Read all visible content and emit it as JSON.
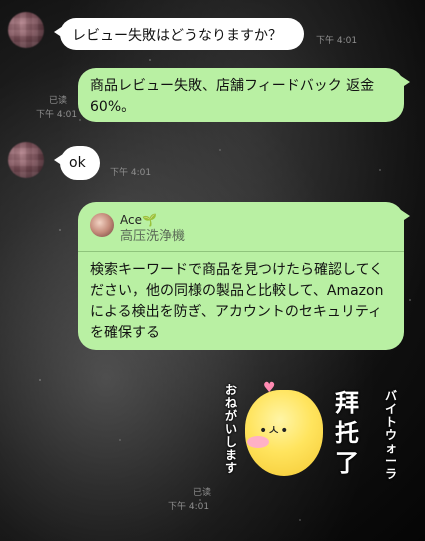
{
  "messages": [
    {
      "text": "レビュー失敗はどうなりますか？",
      "time": "下午 4:01"
    },
    {
      "text": "商品レビュー失敗、店舗フィードバック 返金60%。",
      "read": "已读",
      "time": "下午 4:01"
    },
    {
      "text": "ok",
      "time": "下午 4:01"
    },
    {
      "reply_to": {
        "name": "Ace🌱",
        "text": "高压洗浄機"
      },
      "text": "検索キーワードで商品を見つけたら確認してください，他の同様の製品と比較して、Amazonによる検出を防ぎ、アカウントのセキュリティを確保する"
    }
  ],
  "sticker": {
    "label_main": "拜托了",
    "label_side": "バイトウォーラ",
    "label_left": "おねがいします",
    "read": "已读",
    "time": "下午 4:01"
  },
  "colors": {
    "incoming": "#ffffff",
    "outgoing": "#b9f0a3",
    "timestamp": "#8f8f8f"
  }
}
